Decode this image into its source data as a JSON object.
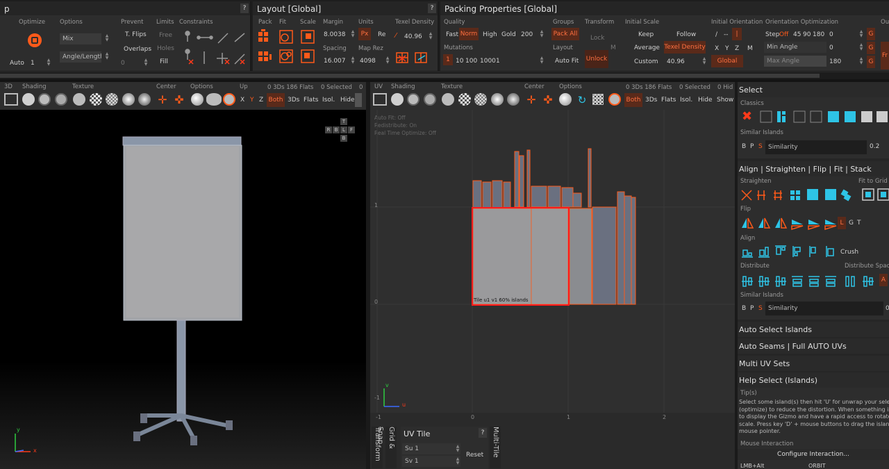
{
  "toolbar": {
    "partial_title": "p",
    "optimize": {
      "label": "Optimize",
      "auto_label": "Auto",
      "auto_value": "1"
    },
    "options": {
      "label": "Options",
      "mode": "Mix",
      "angle_length": "Angle/Length",
      "value": "0"
    },
    "prevent": {
      "label": "Prevent",
      "tflips": "T. Flips",
      "overlaps": "Overlaps",
      "fill": "Fill"
    },
    "limits": {
      "label": "Limits",
      "free": "Free",
      "holes": "Holes"
    },
    "constraints": {
      "label": "Constraints"
    },
    "help": "?"
  },
  "layout": {
    "title": "Layout [Global]",
    "help": "?",
    "pack": "Pack",
    "fit": "Fit",
    "scale": "Scale",
    "margin_label": "Margin",
    "margin_value": "8.0038",
    "spacing_label": "Spacing",
    "spacing_value": "16.007",
    "units_label": "Units",
    "units_px": "Px",
    "units_re": "Re",
    "maprez_label": "Map Rez",
    "maprez_value": "4098",
    "texel_label": "Texel Density",
    "texel_value": "40.96"
  },
  "packing": {
    "title": "Packing Properties [Global]",
    "quality_label": "Quality",
    "quality_options": [
      "Fast",
      "Norm",
      "High",
      "Gold"
    ],
    "quality_selected": "Norm",
    "quality_value": "200",
    "mutations_label": "Mutations",
    "mutation_options": [
      "1",
      "10",
      "100",
      "1000"
    ],
    "mutation_value": "1",
    "groups_label": "Groups",
    "pack_all": "Pack All",
    "layout_label": "Layout",
    "auto_fit": "Auto Fit",
    "transform_label": "Transform",
    "lock": "Lock",
    "m": "M",
    "unlock": "Unlock",
    "initial_scale_label": "Initial Scale",
    "keep": "Keep",
    "follow": "Follow",
    "average": "Average",
    "texel_density": "Texel Density",
    "custom": "Custom",
    "custom_value": "40.96",
    "initial_orient_label": "Initial Orientation",
    "orient_options": [
      "/",
      "--",
      "|"
    ],
    "axes": [
      "X",
      "Y",
      "Z"
    ],
    "axis_m": "M",
    "global": "Global",
    "orient_opt_label": "Orientation Optimization",
    "step_label": "Step",
    "step_off": "Off",
    "step_values": [
      "45",
      "90",
      "180",
      "0"
    ],
    "min_angle": "Min Angle",
    "min_angle_value": "0",
    "max_angle": "Max Angle",
    "max_angle_value": "180",
    "g": "G",
    "partial_ou": "Ou",
    "partial_fr": "Fr"
  },
  "viewport3d": {
    "labels": [
      "3D",
      "Shading",
      "Texture",
      "Center",
      "Options",
      "Up"
    ],
    "stats": "0 3Ds 186 Flats",
    "selected": "0 Selected",
    "zero": "0",
    "axes": [
      "X",
      "Y",
      "Z"
    ],
    "both": "Both",
    "threeds": "3Ds",
    "flats": "Flats",
    "isol": "Isol.",
    "hide": "Hide",
    "cube_faces": [
      "T",
      "B",
      "L",
      "F",
      "R",
      "B"
    ],
    "gizmo_y": "y",
    "gizmo_x": "x"
  },
  "uvview": {
    "labels": [
      "UV",
      "Shading",
      "Texture",
      "Center",
      "Options"
    ],
    "stats": "0 3Ds 186 Flats",
    "selected": "0 Selected",
    "hide_partial": "0 Hid",
    "both": "Both",
    "threeds": "3Ds",
    "flats": "Flats",
    "isol": "Isol.",
    "hide": "Hide",
    "show": "Show",
    "status_lines": [
      "Auto Fit: Off",
      "Redistribute: On",
      "Real Time Optimize: Off"
    ],
    "tile_label": "Tile u1 v1 60%  islands",
    "axis_one": "1",
    "axis_zero": "0",
    "axis_neg": "-1",
    "ruler": [
      "-1",
      "0",
      "1",
      "2"
    ],
    "gizmo_v": "v",
    "gizmo_u": "u"
  },
  "bottom_tabs": {
    "transform": "Transform",
    "grid_snap": "Grid & Snap",
    "multi_tile": "Multi-Tile",
    "uvtile_title": "UV Tile",
    "help": "?",
    "su": "Su",
    "su_value": "1",
    "sv": "Sv",
    "sv_value": "1",
    "reset": "Reset"
  },
  "right_panel": {
    "select_title": "Select",
    "classics": "Classics",
    "similar_islands": "Similar Islands",
    "bps": [
      "B",
      "P",
      "S"
    ],
    "similarity": "Similarity",
    "similarity_value": "0.2",
    "align_title": "Align | Straighten | Flip | Fit | Stack",
    "straighten": "Straighten",
    "fit_to_grid": "Fit to Grid",
    "flip": "Flip",
    "flip_lgt": [
      "L",
      "G",
      "T"
    ],
    "align": "Align",
    "crush": "Crush",
    "distribute": "Distribute",
    "distribute_space": "Distribute Space",
    "a": "A",
    "similar_islands2": "Similar Islands",
    "similarity_value2": "0",
    "auto_select": "Auto Select Islands",
    "auto_seams": "Auto Seams | Full AUTO UVs",
    "multi_uv": "Multi UV Sets",
    "help_select": "Help Select (Islands)",
    "tips_label": "Tip(s)",
    "tip_lines": [
      "Select some island(s) then hit 'U' for unwrap your select",
      "(optimize) to reduce the distortion. When something is",
      "to display the Gizmo and have a rapid access to rotate, t",
      "scale. Press key 'D' + mouse buttons to drag the island t",
      "mouse pointer."
    ],
    "mouse_interaction": "Mouse Interaction",
    "configure": "Configure Interaction...",
    "lmb": "LMB+Alt",
    "orbit": "ORBIT"
  }
}
